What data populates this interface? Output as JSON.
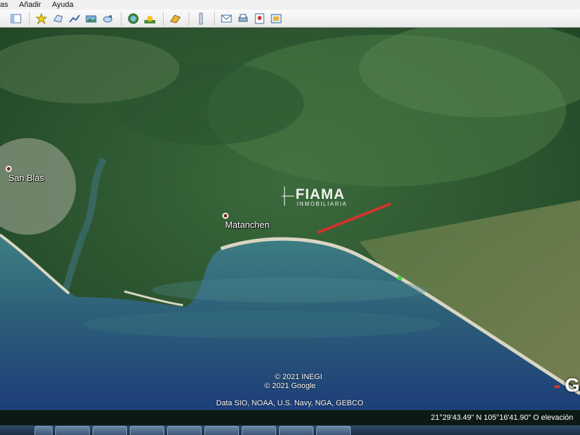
{
  "menu": [
    "as",
    "Añadir",
    "Ayuda"
  ],
  "toolbar": {
    "icons": [
      "sidebar-toggle-icon",
      "placemark-icon",
      "polygon-icon",
      "path-icon",
      "image-overlay-icon",
      "tour-icon",
      "historical-imagery-icon",
      "sunlight-icon",
      "planets-icon",
      "ruler-icon",
      "email-icon",
      "print-icon",
      "save-image-icon",
      "view-maps-icon"
    ]
  },
  "map": {
    "places": [
      {
        "name": "San Blas"
      },
      {
        "name": "Matanchen"
      }
    ],
    "watermark": {
      "title": "FIAMA",
      "subtitle": "INMOBILIARIA"
    },
    "credits": {
      "line1": "© 2021 INEGI",
      "line2": "© 2021 Google",
      "line3": "Data SIO, NOAA, U.S. Navy, NGA, GEBCO"
    },
    "logo_letter": "G",
    "marker_color": "#d0342c"
  },
  "status": {
    "coordinates": "21°29'43.49\" N  105°16'41.90\" O  elevación"
  },
  "taskbar": {
    "apps": [
      "explorer-icon",
      "ie-icon",
      "chrome-icon",
      "excel-icon",
      "word-icon",
      "photoshop-icon",
      "word-doc-icon",
      "winrar-icon",
      "powerpoint-icon"
    ]
  }
}
